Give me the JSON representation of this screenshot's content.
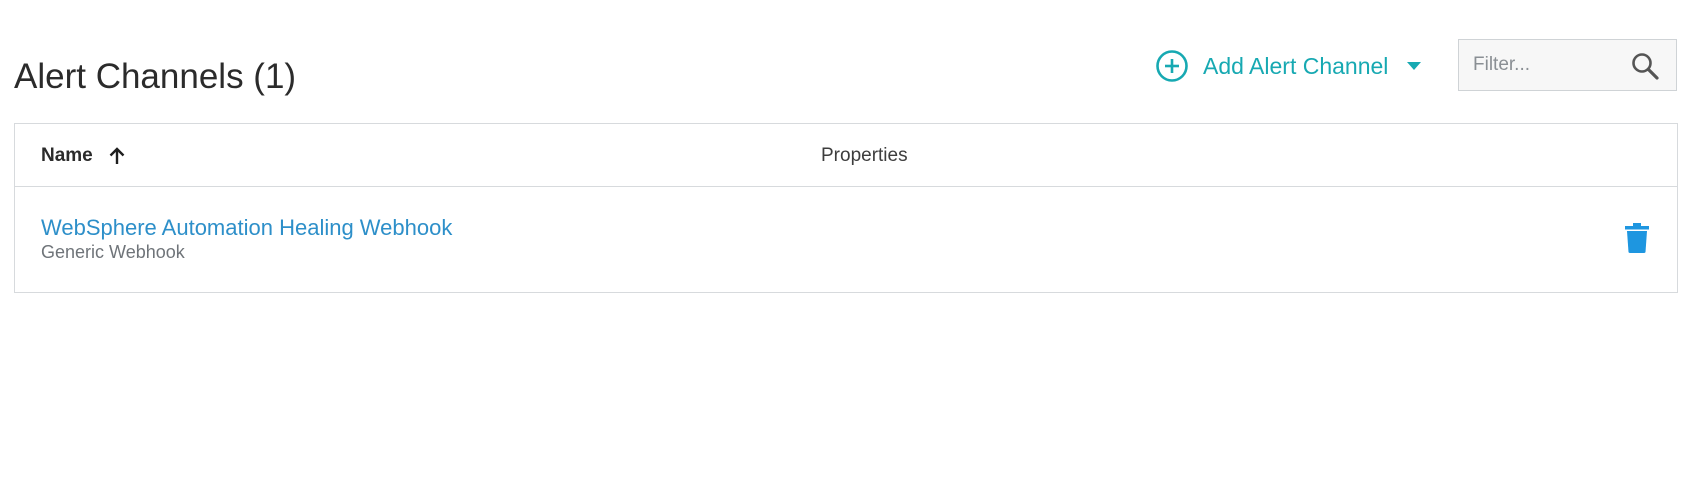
{
  "header": {
    "title": "Alert Channels (1)",
    "add_button_label": "Add Alert Channel",
    "add_button_icon": "plus-circle-icon",
    "dropdown_icon": "caret-down-icon",
    "accent_color": "#17a9b2"
  },
  "filter": {
    "placeholder": "Filter...",
    "value": "",
    "icon": "search-icon"
  },
  "table": {
    "columns": {
      "name": "Name",
      "properties": "Properties"
    },
    "sort": {
      "column": "Name",
      "direction": "ascending",
      "icon": "arrow-up-icon"
    },
    "rows": [
      {
        "name": "WebSphere Automation Healing Webhook",
        "type": "Generic Webhook",
        "properties": "",
        "delete_icon": "trash-icon"
      }
    ],
    "link_color": "#2d8fc9",
    "delete_color": "#1e96e0"
  }
}
